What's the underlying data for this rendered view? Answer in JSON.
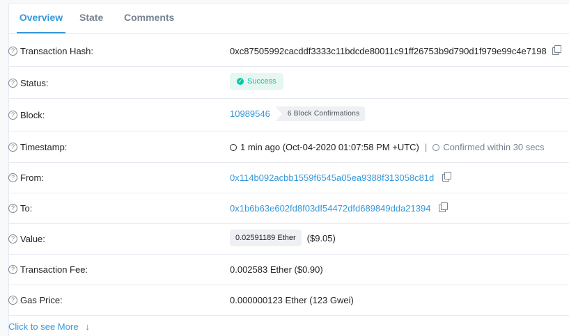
{
  "tabs": [
    "Overview",
    "State",
    "Comments"
  ],
  "rows": {
    "hash": {
      "label": "Transaction Hash:",
      "value": "0xc87505992cacddf3333c11bdcde80011c91ff26753b9d790d1f979e99c4e7198"
    },
    "status": {
      "label": "Status:",
      "value": "Success"
    },
    "block": {
      "label": "Block:",
      "number": "10989546",
      "confirmations": "6 Block Confirmations"
    },
    "timestamp": {
      "label": "Timestamp:",
      "ago": "1 min ago (Oct-04-2020 01:07:58 PM +UTC)",
      "separator": "|",
      "confirmed": "Confirmed within 30 secs"
    },
    "from": {
      "label": "From:",
      "value": "0x114b092acbb1559f6545a05ea9388f313058c81d"
    },
    "to": {
      "label": "To:",
      "value": "0x1b6b63e602fd8f03df54472dfd689849dda21394"
    },
    "value": {
      "label": "Value:",
      "ether": "0.02591189 Ether",
      "usd": "($9.05)"
    },
    "fee": {
      "label": "Transaction Fee:",
      "value": "0.002583 Ether ($0.90)"
    },
    "gas": {
      "label": "Gas Price:",
      "value": "0.000000123 Ether (123 Gwei)"
    }
  },
  "more_link": "Click to see More",
  "icons": {
    "help": "question-circle-icon",
    "copy": "copy-icon",
    "success": "check-circle-icon",
    "clock": "clock-icon",
    "arrow": "arrow-down-icon"
  },
  "colors": {
    "link": "#3498db",
    "success": "#00c9a7",
    "muted": "#77838f"
  }
}
